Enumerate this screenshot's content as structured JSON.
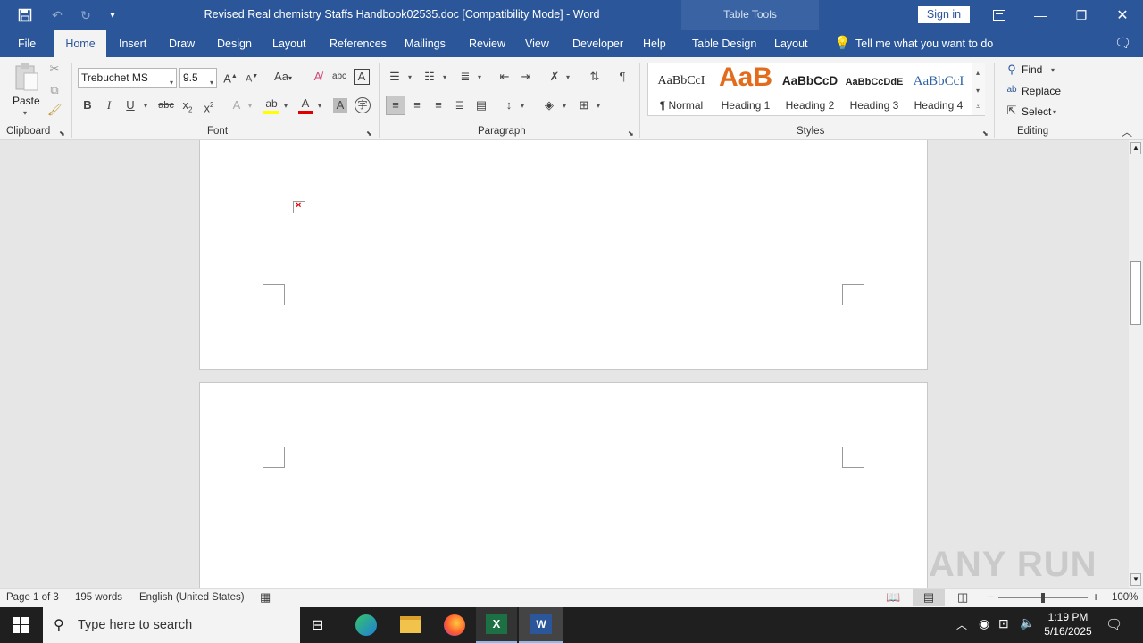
{
  "window": {
    "title": "Revised Real chemistry Staffs Handbook02535.doc [Compatibility Mode]  -  Word",
    "context_tab_group": "Table Tools",
    "sign_in": "Sign in"
  },
  "tabs": [
    "File",
    "Home",
    "Insert",
    "Draw",
    "Design",
    "Layout",
    "References",
    "Mailings",
    "Review",
    "View",
    "Developer",
    "Help",
    "Table Design",
    "Layout"
  ],
  "active_tab": "Home",
  "tell_me": "Tell me what you want to do",
  "ribbon": {
    "clipboard": {
      "paste_label": "Paste",
      "group_label": "Clipboard"
    },
    "font": {
      "family": "Trebuchet MS",
      "size": "9.5",
      "group_label": "Font",
      "highlight_color": "#ffff00",
      "font_color": "#e00000"
    },
    "paragraph": {
      "group_label": "Paragraph"
    },
    "styles": {
      "group_label": "Styles",
      "items": [
        {
          "preview": "AaBbCcI",
          "name": "¶ Normal"
        },
        {
          "preview": "AaB",
          "name": "Heading 1"
        },
        {
          "preview": "AaBbCcD",
          "name": "Heading 2"
        },
        {
          "preview": "AaBbCcDdE",
          "name": "Heading 3"
        },
        {
          "preview": "AaBbCcI",
          "name": "Heading 4"
        }
      ]
    },
    "editing": {
      "find": "Find",
      "replace": "Replace",
      "select": "Select",
      "group_label": "Editing"
    }
  },
  "status": {
    "page": "Page 1 of 3",
    "words": "195 words",
    "language": "English (United States)",
    "zoom": "100%"
  },
  "taskbar": {
    "search_placeholder": "Type here to search",
    "time": "1:19 PM",
    "date": "5/16/2025"
  },
  "watermark": "ANY RUN",
  "colors": {
    "brand": "#2b579a",
    "ribbon_bg": "#f3f3f3",
    "doc_bg": "#e6e6e6"
  }
}
